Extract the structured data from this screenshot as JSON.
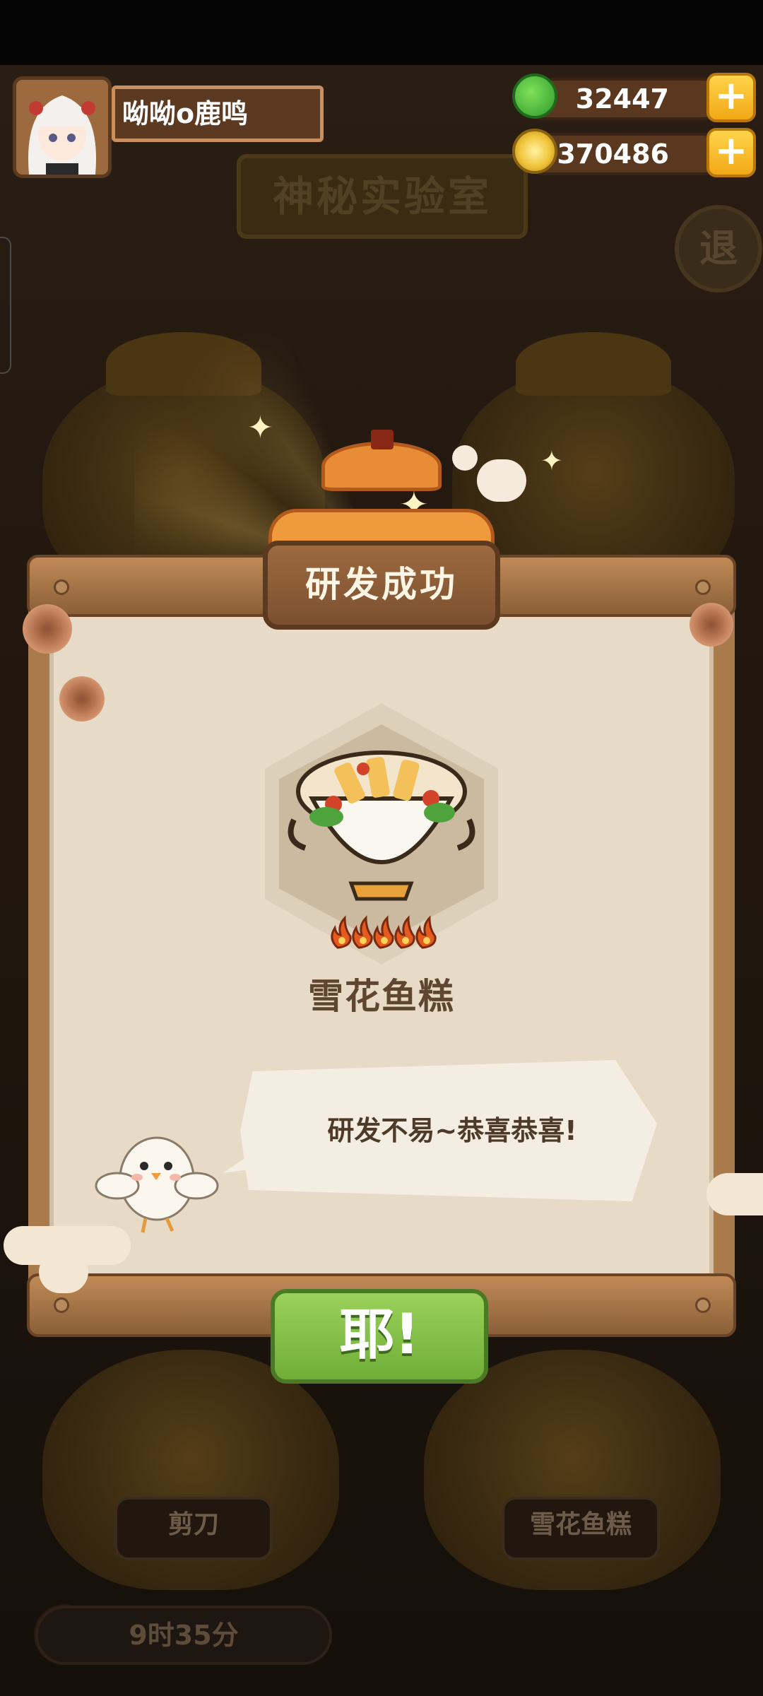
{
  "player": {
    "name": "呦呦o鹿鸣"
  },
  "resources": {
    "jade": "32447",
    "coins": "370486",
    "add_symbol": "+"
  },
  "background": {
    "lab_title": "神秘实验室",
    "back_label": "退",
    "left_pot_label": "剪刀",
    "right_pot_label": "雪花鱼糕",
    "timer": "9时35分"
  },
  "dialog": {
    "title": "研发成功",
    "dish_name": "雪花鱼糕",
    "rating": 5,
    "message": "研发不易~恭喜恭喜!",
    "confirm_label": "耶!"
  },
  "colors": {
    "accent_green": "#7bbd44",
    "wood": "#8a5f38",
    "paper": "#e7dbc8"
  }
}
